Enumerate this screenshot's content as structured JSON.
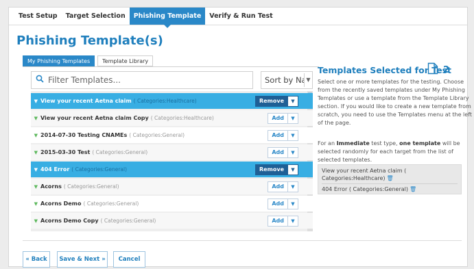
{
  "tabs": [
    "Test Setup",
    "Target Selection",
    "Phishing Template",
    "Verify & Run Test"
  ],
  "active_tab": 2,
  "page_title": "Phishing Template(s)",
  "sub_tabs": [
    "My Phishing Templates",
    "Template Library"
  ],
  "filter": {
    "placeholder": "Filter Templates..."
  },
  "sort": {
    "label": "Sort by Nar"
  },
  "templates": [
    {
      "name": "View your recent Aetna claim",
      "category": "( Categories:Healthcare)",
      "action": "Remove",
      "selected": true
    },
    {
      "name": "View your recent Aetna claim Copy",
      "category": "( Categories:Healthcare)",
      "action": "Add",
      "selected": false
    },
    {
      "name": "2014-07-30 Testing CNAMEs",
      "category": "( Categories:General)",
      "action": "Add",
      "selected": false
    },
    {
      "name": "2015-03-30 Test",
      "category": "( Categories:General)",
      "action": "Add",
      "selected": false
    },
    {
      "name": "404 Error",
      "category": "( Categories:General)",
      "action": "Remove",
      "selected": true
    },
    {
      "name": "Acorns",
      "category": "( Categories:General)",
      "action": "Add",
      "selected": false
    },
    {
      "name": "Acorns Demo",
      "category": "( Categories:General)",
      "action": "Add",
      "selected": false
    },
    {
      "name": "Acorns Demo Copy",
      "category": "( Categories:General)",
      "action": "Add",
      "selected": false
    }
  ],
  "selected_panel": {
    "title": "Templates Selected for Test",
    "count": "2",
    "help1": "Select one or more templates for the testing. Choose from the recently saved templates under My Phishing Templates or use a template from the Template Library section. If you would like to create a new template from scratch, you need to use the Templates menu at the left of the page.",
    "help2_prefix": "For an ",
    "help2_bold1": "Immediate",
    "help2_mid": " test type, ",
    "help2_bold2": "one template",
    "help2_suffix": " will be selected randomly for each target from the list of selected templates.",
    "items": [
      "View your recent Aetna claim ( Categories:Healthcare)",
      "404 Error ( Categories:General)"
    ]
  },
  "footer": {
    "back": "« Back",
    "save_next": "Save & Next »",
    "cancel": "Cancel"
  },
  "colors": {
    "accent": "#2a88c8",
    "selected_row": "#38aee3",
    "remove_button": "#1f5f95"
  }
}
